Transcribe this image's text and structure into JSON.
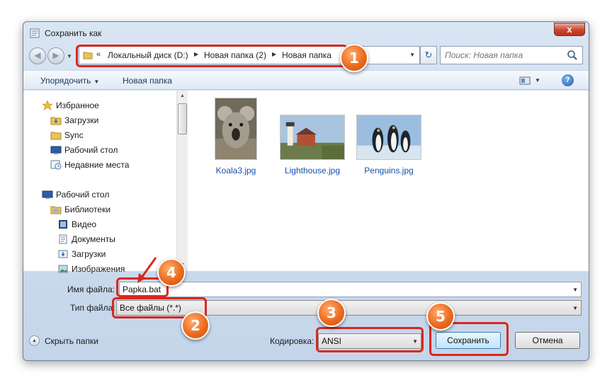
{
  "window": {
    "title": "Сохранить как",
    "close_label": "x"
  },
  "address": {
    "chevron": "«",
    "segments": [
      "Локальный диск (D:)",
      "Новая папка (2)",
      "Новая папка"
    ]
  },
  "search": {
    "placeholder": "Поиск: Новая папка"
  },
  "toolbar": {
    "organize_label": "Упорядочить",
    "new_folder_label": "Новая папка",
    "help_label": "?"
  },
  "sidebar": {
    "favorites": [
      {
        "label": "Избранное",
        "icon": "star-icon"
      },
      {
        "label": "Загрузки",
        "icon": "downloads-folder-icon"
      },
      {
        "label": "Sync",
        "icon": "folder-icon"
      },
      {
        "label": "Рабочий стол",
        "icon": "desktop-icon"
      },
      {
        "label": "Недавние места",
        "icon": "recent-places-icon"
      }
    ],
    "tree": [
      {
        "label": "Рабочий стол",
        "icon": "desktop-icon"
      },
      {
        "label": "Библиотеки",
        "icon": "libraries-icon"
      },
      {
        "label": "Видео",
        "icon": "video-library-icon"
      },
      {
        "label": "Документы",
        "icon": "documents-library-icon"
      },
      {
        "label": "Загрузки",
        "icon": "downloads-library-icon"
      },
      {
        "label": "Изображения",
        "icon": "pictures-library-icon"
      }
    ]
  },
  "files": [
    {
      "name": "Koala3.jpg"
    },
    {
      "name": "Lighthouse.jpg"
    },
    {
      "name": "Penguins.jpg"
    }
  ],
  "form": {
    "filename_label": "Имя файла:",
    "filename_value": "Papka.bat",
    "filetype_label": "Тип файла:",
    "filetype_value": "Все файлы  (*.*)",
    "encoding_label": "Кодировка:",
    "encoding_value": "ANSI",
    "hide_folders_label": "Скрыть папки",
    "save_label": "Сохранить",
    "cancel_label": "Отмена"
  },
  "annotations": {
    "markers": [
      "1",
      "2",
      "3",
      "4",
      "5"
    ],
    "color": "#d8281f",
    "badge_color": "#ec6a1e"
  }
}
